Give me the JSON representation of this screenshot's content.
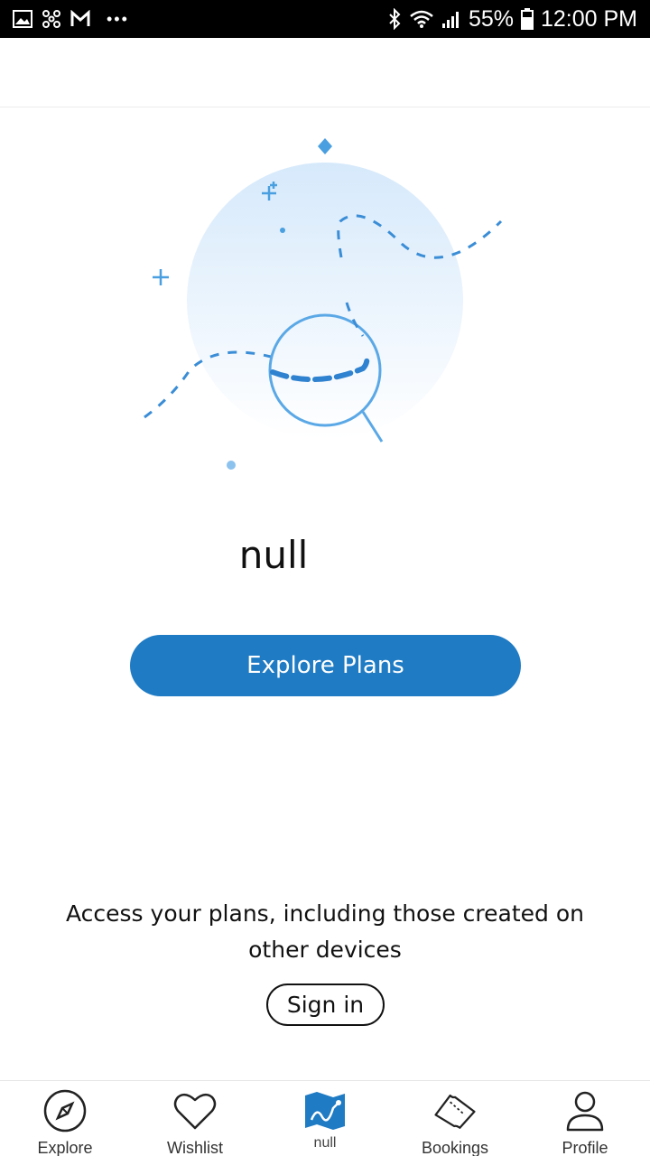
{
  "status_bar": {
    "battery": "55%",
    "time": "12:00 PM",
    "left_icons": [
      "image-icon",
      "fan-icon",
      "gmail-icon",
      "more-dots-icon"
    ],
    "right_icons": [
      "bluetooth-icon",
      "wifi-icon",
      "signal-icon",
      "battery-icon"
    ]
  },
  "main": {
    "title": "null",
    "explore_button": "Explore Plans",
    "access_text": "Access your plans, including those created on other devices",
    "signin_button": "Sign in"
  },
  "nav": {
    "items": [
      {
        "label": "Explore",
        "icon": "compass-icon"
      },
      {
        "label": "Wishlist",
        "icon": "heart-icon"
      },
      {
        "label": "null",
        "icon": "map-icon",
        "active": true
      },
      {
        "label": "Bookings",
        "icon": "ticket-icon"
      },
      {
        "label": "Profile",
        "icon": "person-icon"
      }
    ]
  },
  "colors": {
    "accent": "#1e7bc4",
    "illustration_blue": "#4a9fe0",
    "circle_light": "#dcecfb"
  }
}
